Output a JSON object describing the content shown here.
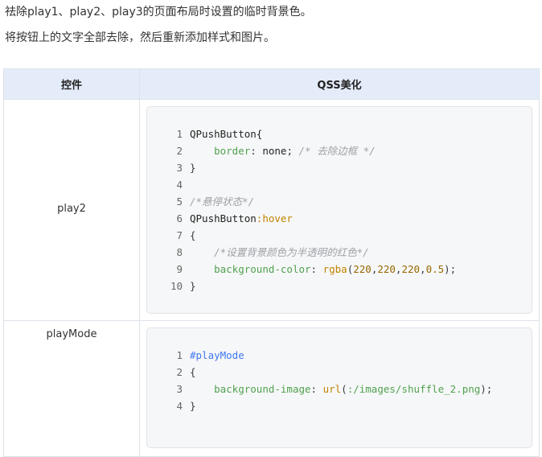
{
  "paragraphs": [
    "祛除play1、play2、play3的页面布局时设置的临时背景色。",
    "将按钮上的文字全部去除，然后重新添加样式和图片。"
  ],
  "table": {
    "headers": [
      "控件",
      "QSS美化"
    ],
    "rows": [
      {
        "control": "play2",
        "code": [
          {
            "n": "1",
            "t": [
              [
                "sel",
                "QPushButton{"
              ]
            ]
          },
          {
            "n": "2",
            "t": [
              [
                "sp",
                "    "
              ],
              [
                "prop",
                "border"
              ],
              [
                "punc",
                ": "
              ],
              [
                "val",
                "none"
              ],
              [
                "punc",
                "; "
              ],
              [
                "cmt",
                "/* 去除边框 */"
              ]
            ]
          },
          {
            "n": "3",
            "t": [
              [
                "punc",
                "}"
              ]
            ]
          },
          {
            "n": "4",
            "t": []
          },
          {
            "n": "5",
            "t": [
              [
                "cmt",
                "/*悬停状态*/"
              ]
            ]
          },
          {
            "n": "6",
            "t": [
              [
                "sel",
                "QPushButton"
              ],
              [
                "pseudo",
                ":hover"
              ]
            ]
          },
          {
            "n": "7",
            "t": [
              [
                "punc",
                "{"
              ]
            ]
          },
          {
            "n": "8",
            "t": [
              [
                "sp",
                "    "
              ],
              [
                "cmt",
                "/*设置背景颜色为半透明的红色*/"
              ]
            ]
          },
          {
            "n": "9",
            "t": [
              [
                "sp",
                "    "
              ],
              [
                "prop",
                "background-color"
              ],
              [
                "punc",
                ": "
              ],
              [
                "fn",
                "rgba"
              ],
              [
                "punc",
                "("
              ],
              [
                "num",
                "220"
              ],
              [
                "punc",
                ","
              ],
              [
                "num",
                "220"
              ],
              [
                "punc",
                ","
              ],
              [
                "num",
                "220"
              ],
              [
                "punc",
                ","
              ],
              [
                "num",
                "0.5"
              ],
              [
                "punc",
                ");"
              ]
            ]
          },
          {
            "n": "10",
            "t": [
              [
                "punc",
                "}"
              ]
            ]
          }
        ]
      },
      {
        "control": "playMode",
        "code": [
          {
            "n": "1",
            "t": [
              [
                "id",
                "#playMode"
              ]
            ]
          },
          {
            "n": "2",
            "t": [
              [
                "punc",
                "{"
              ]
            ]
          },
          {
            "n": "3",
            "t": [
              [
                "sp",
                "    "
              ],
              [
                "prop",
                "background-image"
              ],
              [
                "punc",
                ": "
              ],
              [
                "fn",
                "url"
              ],
              [
                "punc",
                "("
              ],
              [
                "str",
                ":/images/shuffle_2.png"
              ],
              [
                "punc",
                ");"
              ]
            ]
          },
          {
            "n": "4",
            "t": [
              [
                "punc",
                "}"
              ]
            ]
          }
        ]
      }
    ]
  }
}
